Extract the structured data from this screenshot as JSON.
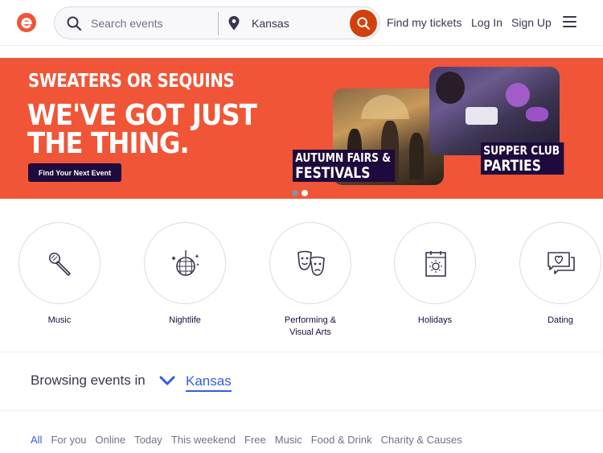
{
  "colors": {
    "brand": "#f05537",
    "brand_dark": "#d1410c",
    "navy": "#1e0a3c",
    "link_blue": "#3659e3"
  },
  "header": {
    "search": {
      "placeholder": "Search events",
      "icon": "search-icon"
    },
    "location": {
      "value": "Kansas",
      "icon": "location-pin-icon"
    },
    "search_button_icon": "search-icon",
    "links": {
      "find_tickets": "Find my tickets",
      "login": "Log In",
      "signup": "Sign Up"
    },
    "menu_icon": "hamburger-menu-icon"
  },
  "hero": {
    "tag": "SWEATERS OR SEQUINS",
    "headline_line1": "WE'VE GOT JUST",
    "headline_line2": "THE THING.",
    "cta": "Find Your Next Event",
    "card1": {
      "line1": "AUTUMN FAIRS &",
      "line2": "FESTIVALS"
    },
    "card2": {
      "line1": "SUPPER CLUB",
      "line2": "PARTIES"
    },
    "carousel_active_index": 1,
    "carousel_count": 2
  },
  "categories": [
    {
      "label": "Music",
      "icon": "microphone-icon"
    },
    {
      "label": "Nightlife",
      "icon": "disco-ball-icon"
    },
    {
      "label": "Performing & Visual Arts",
      "icon": "theater-masks-icon"
    },
    {
      "label": "Holidays",
      "icon": "calendar-sun-icon"
    },
    {
      "label": "Dating",
      "icon": "chat-heart-icon"
    }
  ],
  "browse": {
    "prefix": "Browsing events in",
    "location": "Kansas",
    "icon": "chevron-down-icon"
  },
  "tabs": [
    {
      "label": "All",
      "active": true
    },
    {
      "label": "For you"
    },
    {
      "label": "Online"
    },
    {
      "label": "Today"
    },
    {
      "label": "This weekend"
    },
    {
      "label": "Free"
    },
    {
      "label": "Music"
    },
    {
      "label": "Food & Drink"
    },
    {
      "label": "Charity & Causes"
    }
  ]
}
